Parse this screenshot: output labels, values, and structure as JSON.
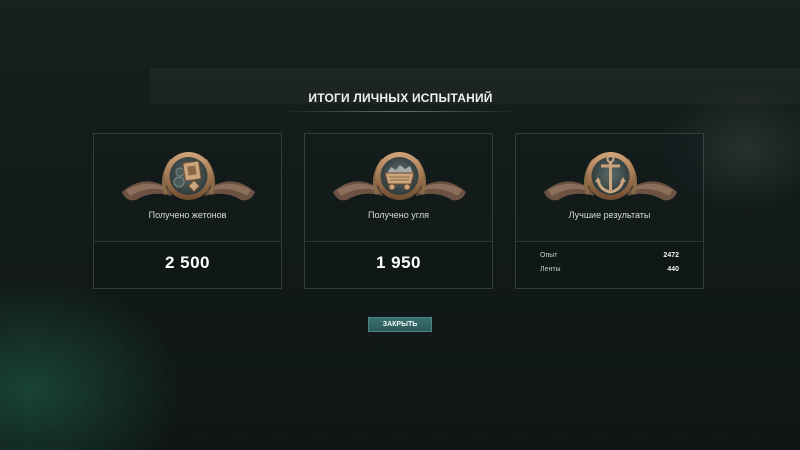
{
  "dialog": {
    "title": "ИТОГИ ЛИЧНЫХ ИСПЫТАНИЙ",
    "close_label": "ЗАКРЫТЬ"
  },
  "cards": [
    {
      "icon": "token-medal-icon",
      "label": "Получено жетонов",
      "value": "2 500"
    },
    {
      "icon": "coal-cart-medal-icon",
      "label": "Получено угля",
      "value": "1 950"
    },
    {
      "icon": "anchor-medal-icon",
      "label": "Лучшие результаты",
      "stats": [
        {
          "label": "Опыт",
          "value": "2472"
        },
        {
          "label": "Ленты",
          "value": "440"
        }
      ]
    }
  ],
  "colors": {
    "button": "#2f5f60",
    "medal_bronze": "#a9784e",
    "background": "#131b1a"
  }
}
